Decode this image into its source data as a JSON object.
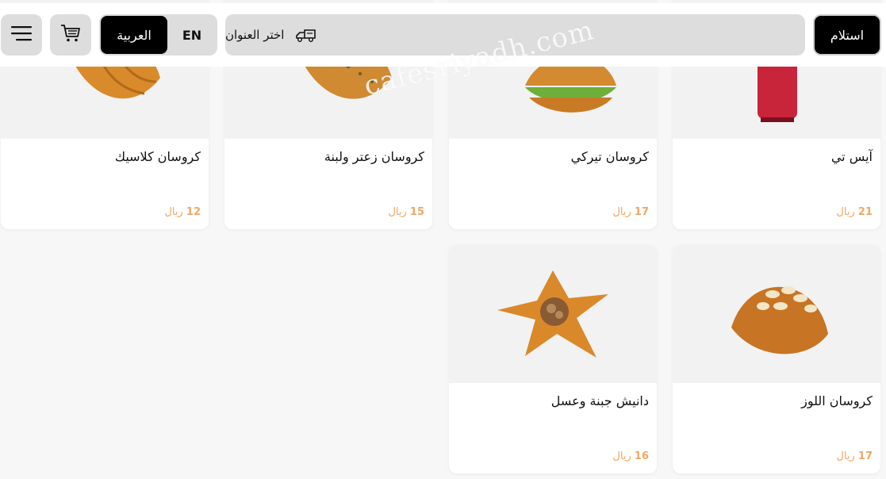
{
  "header": {
    "pickup_label": "استلام",
    "address_label": "اختر العنوان",
    "lang_ar": "العربية",
    "lang_en": "EN",
    "icons": {
      "menu": "hamburger-icon",
      "cart": "cart-icon",
      "address": "delivery-truck-icon"
    }
  },
  "watermark": "cafesriyadh.com",
  "products": [
    {
      "name": "كروسان كلاسيك",
      "price": "12",
      "currency": "ريال"
    },
    {
      "name": "كروسان زعتر ولبنة",
      "price": "15",
      "currency": "ريال"
    },
    {
      "name": "كروسان تيركي",
      "price": "17",
      "currency": "ريال"
    },
    {
      "name": "آيس تي",
      "price": "21",
      "currency": "ريال"
    },
    {
      "name": "دانيش جبنة وعسل",
      "price": "16",
      "currency": "ريال"
    },
    {
      "name": "كروسان اللوز",
      "price": "17",
      "currency": "ريال"
    }
  ],
  "colors": {
    "accent_price": "#f0a765",
    "button_dark": "#000000",
    "button_light": "#dddddd"
  }
}
